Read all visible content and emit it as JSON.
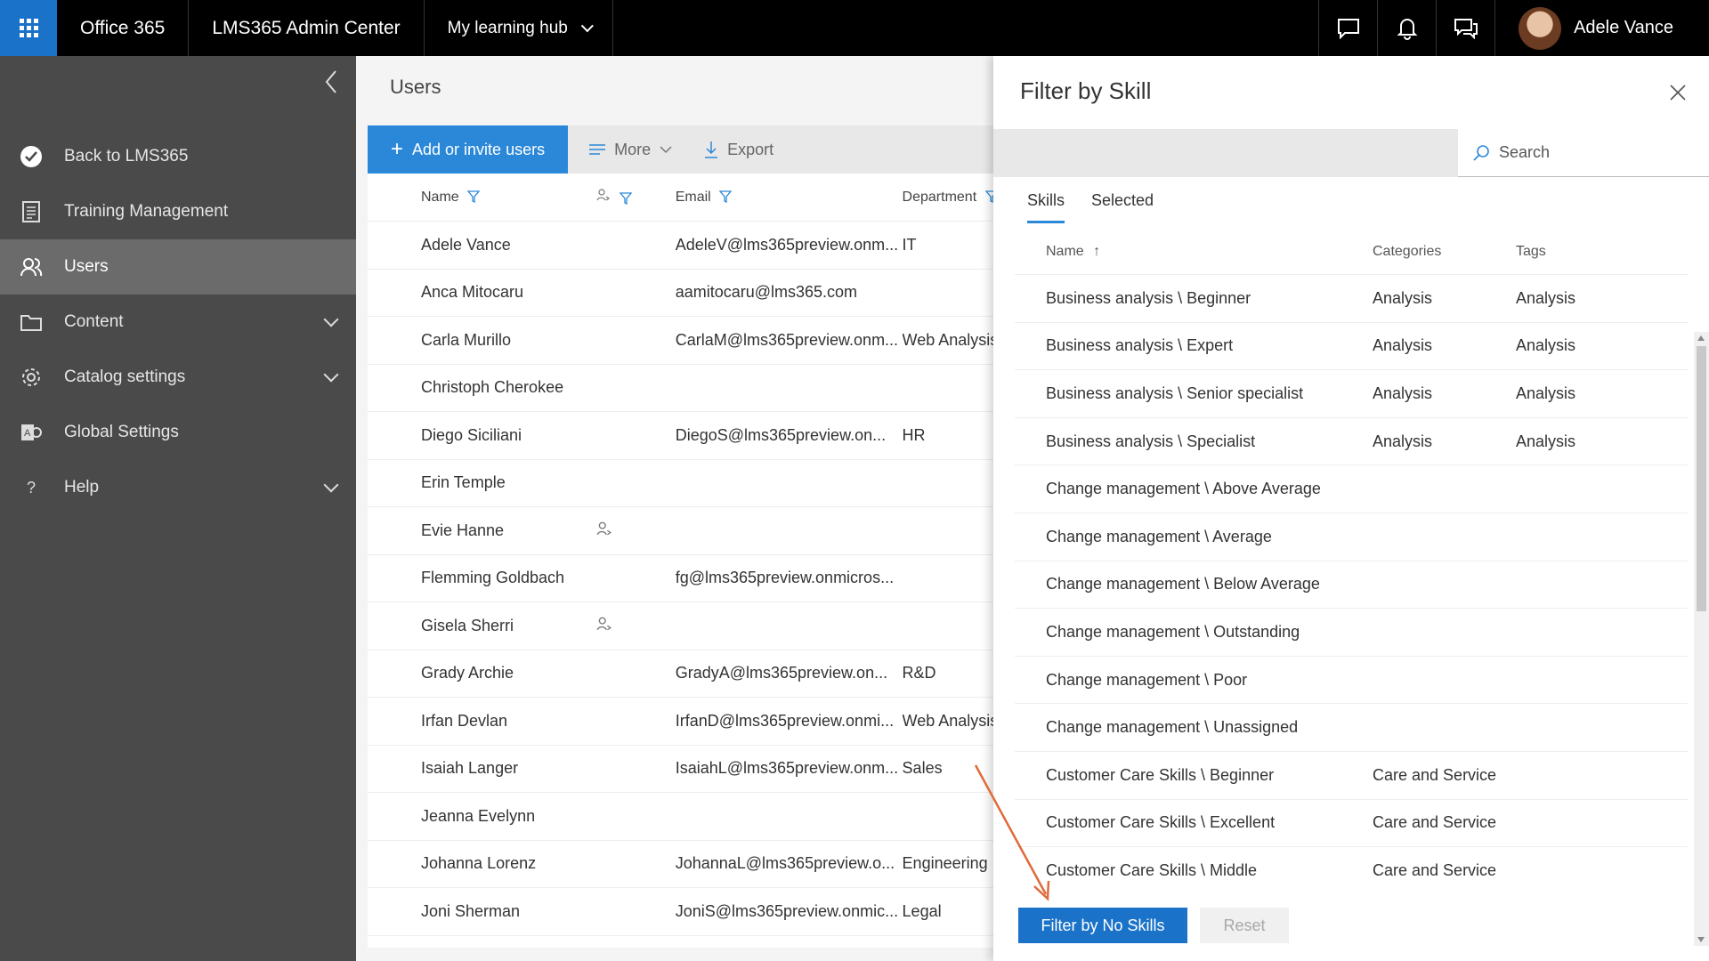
{
  "topbar": {
    "app_name": "Office 365",
    "admin_center": "LMS365 Admin Center",
    "hub": "My learning hub",
    "user_name": "Adele Vance"
  },
  "sidebar": {
    "items": [
      {
        "label": "Back to LMS365",
        "icon": "check-circle-icon"
      },
      {
        "label": "Training Management",
        "icon": "document-icon"
      },
      {
        "label": "Users",
        "icon": "users-icon",
        "active": true
      },
      {
        "label": "Content",
        "icon": "folder-icon",
        "expandable": true
      },
      {
        "label": "Catalog settings",
        "icon": "gear-icon",
        "expandable": true
      },
      {
        "label": "Global Settings",
        "icon": "settings-app-icon"
      },
      {
        "label": "Help",
        "icon": "help-icon",
        "expandable": true
      }
    ]
  },
  "main": {
    "title": "Users",
    "toolbar": {
      "add_label": "Add or invite users",
      "more_label": "More",
      "export_label": "Export"
    },
    "columns": {
      "name": "Name",
      "email": "Email",
      "department": "Department"
    },
    "users": [
      {
        "name": "Adele Vance",
        "external": false,
        "email": "AdeleV@lms365preview.onm...",
        "department": "IT"
      },
      {
        "name": "Anca Mitocaru",
        "external": false,
        "email": "aamitocaru@lms365.com",
        "department": ""
      },
      {
        "name": "Carla Murillo",
        "external": false,
        "email": "CarlaM@lms365preview.onm...",
        "department": "Web Analysis"
      },
      {
        "name": "Christoph Cherokee",
        "external": false,
        "email": "",
        "department": ""
      },
      {
        "name": "Diego Siciliani",
        "external": false,
        "email": "DiegoS@lms365preview.on...",
        "department": "HR"
      },
      {
        "name": "Erin Temple",
        "external": false,
        "email": "",
        "department": ""
      },
      {
        "name": "Evie Hanne",
        "external": true,
        "email": "",
        "department": ""
      },
      {
        "name": "Flemming Goldbach",
        "external": false,
        "email": "fg@lms365preview.onmicros...",
        "department": ""
      },
      {
        "name": "Gisela Sherri",
        "external": true,
        "email": "",
        "department": ""
      },
      {
        "name": "Grady Archie",
        "external": false,
        "email": "GradyA@lms365preview.on...",
        "department": "R&D"
      },
      {
        "name": "Irfan Devlan",
        "external": false,
        "email": "IrfanD@lms365preview.onmi...",
        "department": "Web Analysis"
      },
      {
        "name": "Isaiah Langer",
        "external": false,
        "email": "IsaiahL@lms365preview.onm...",
        "department": "Sales"
      },
      {
        "name": "Jeanna Evelynn",
        "external": false,
        "email": "",
        "department": ""
      },
      {
        "name": "Johanna Lorenz",
        "external": false,
        "email": "JohannaL@lms365preview.o...",
        "department": "Engineering"
      },
      {
        "name": "Joni Sherman",
        "external": false,
        "email": "JoniS@lms365preview.onmic...",
        "department": "Legal"
      }
    ]
  },
  "panel": {
    "title": "Filter by Skill",
    "search_placeholder": "Search",
    "tabs": [
      "Skills",
      "Selected"
    ],
    "columns": {
      "name": "Name",
      "categories": "Categories",
      "tags": "Tags"
    },
    "skills": [
      {
        "name": "Business analysis \\ Beginner",
        "category": "Analysis",
        "tag": "Analysis"
      },
      {
        "name": "Business analysis \\ Expert",
        "category": "Analysis",
        "tag": "Analysis"
      },
      {
        "name": "Business analysis \\ Senior specialist",
        "category": "Analysis",
        "tag": "Analysis"
      },
      {
        "name": "Business analysis \\ Specialist",
        "category": "Analysis",
        "tag": "Analysis"
      },
      {
        "name": "Change management \\ Above Average",
        "category": "",
        "tag": ""
      },
      {
        "name": "Change management \\ Average",
        "category": "",
        "tag": ""
      },
      {
        "name": "Change management \\ Below Average",
        "category": "",
        "tag": ""
      },
      {
        "name": "Change management \\ Outstanding",
        "category": "",
        "tag": ""
      },
      {
        "name": "Change management \\ Poor",
        "category": "",
        "tag": ""
      },
      {
        "name": "Change management \\ Unassigned",
        "category": "",
        "tag": ""
      },
      {
        "name": "Customer Care Skills \\ Beginner",
        "category": "Care and Service",
        "tag": ""
      },
      {
        "name": "Customer Care Skills \\ Excellent",
        "category": "Care and Service",
        "tag": ""
      },
      {
        "name": "Customer Care Skills \\ Middle",
        "category": "Care and Service",
        "tag": ""
      }
    ],
    "filter_button": "Filter by No Skills",
    "reset_button": "Reset"
  },
  "colors": {
    "accent": "#2b88d8",
    "topbar": "#000000",
    "sidebar": "#4a4a4a",
    "annotation_arrow": "#e06a3a"
  }
}
